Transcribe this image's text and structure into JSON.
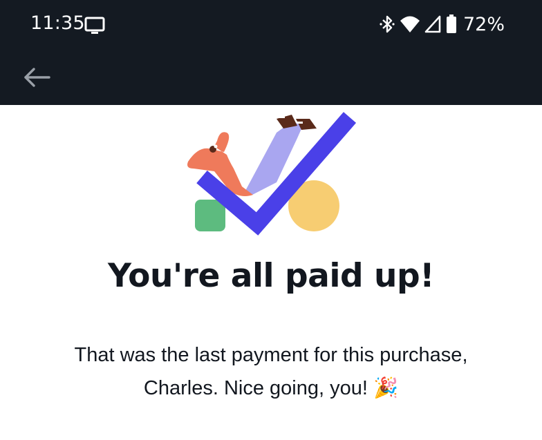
{
  "status_bar": {
    "time": "11:35",
    "battery": "72%",
    "icons": [
      "cast-icon",
      "bluetooth-icon",
      "wifi-icon",
      "signal-icon",
      "battery-icon"
    ]
  },
  "app_bar": {
    "back_icon": "arrow-left-icon"
  },
  "hero": {
    "illustration": "payment-complete-checkmark-illustration",
    "colors": {
      "check": "#4a40e8",
      "circle": "#f7cd72",
      "square": "#5dbb7f",
      "figure_skin": "#ef7a5b",
      "figure_pants": "#a9a6f0",
      "figure_shoes": "#5a2a1a"
    }
  },
  "content": {
    "title": "You're all paid up!",
    "message_line1": "That was the last payment for this purchase,",
    "message_line2": "Charles. Nice going, you!",
    "message_emoji": "🎉"
  }
}
